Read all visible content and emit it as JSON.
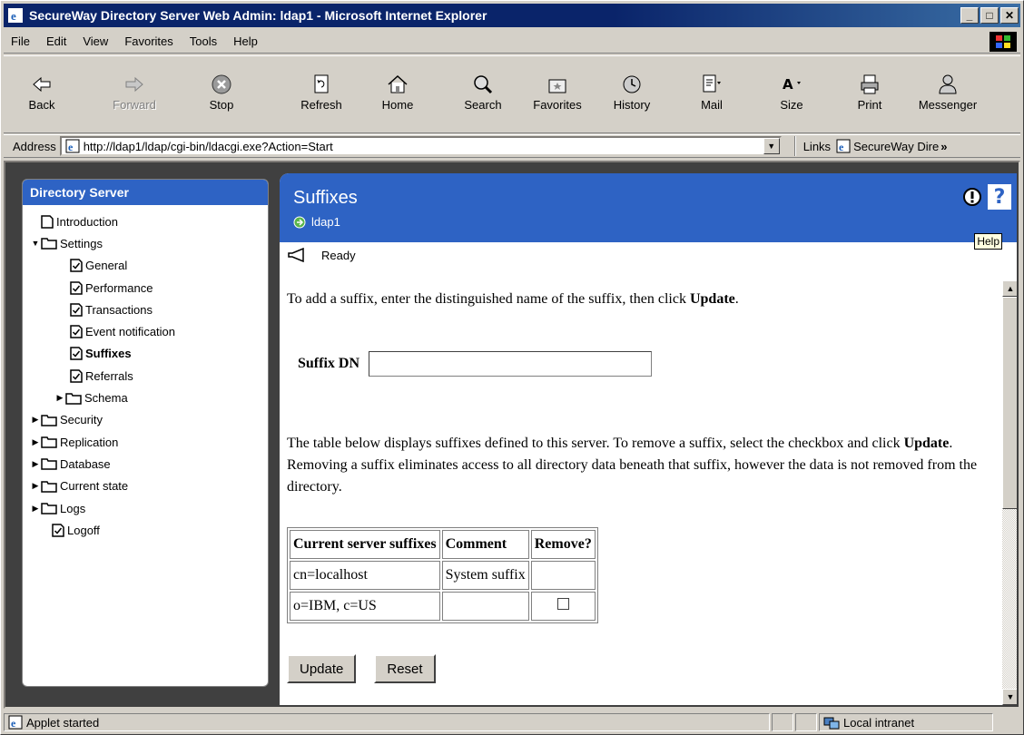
{
  "window": {
    "title": "SecureWay Directory Server Web Admin: ldap1 - Microsoft Internet Explorer"
  },
  "menu": [
    "File",
    "Edit",
    "View",
    "Favorites",
    "Tools",
    "Help"
  ],
  "toolbar": {
    "back": "Back",
    "forward": "Forward",
    "stop": "Stop",
    "refresh": "Refresh",
    "home": "Home",
    "search": "Search",
    "favorites": "Favorites",
    "history": "History",
    "mail": "Mail",
    "size": "Size",
    "print": "Print",
    "messenger": "Messenger"
  },
  "address": {
    "label": "Address",
    "url": "http://ldap1/ldap/cgi-bin/ldacgi.exe?Action=Start",
    "links_label": "Links",
    "links_item": "SecureWay Dire"
  },
  "nav": {
    "header": "Directory Server",
    "items": [
      "Introduction",
      "Settings",
      "General",
      "Performance",
      "Transactions",
      "Event notification",
      "Suffixes",
      "Referrals",
      "Schema",
      "Security",
      "Replication",
      "Database",
      "Current state",
      "Logs",
      "Logoff"
    ]
  },
  "panel": {
    "title": "Suffixes",
    "server": "ldap1",
    "help_tooltip": "Help",
    "status": "Ready",
    "intro_pre": "To add a suffix, enter the distinguished name of the suffix, then click ",
    "intro_bold": "Update",
    "intro_post": ".",
    "suffix_dn_label": "Suffix DN",
    "suffix_dn_value": "",
    "desc_pre": "The table below displays suffixes defined to this server. To remove a suffix, select the checkbox and click ",
    "desc_bold": "Update",
    "desc_post": ". Removing a suffix eliminates access to all directory data beneath that suffix, however the data is not removed from the directory.",
    "table": {
      "headers": [
        "Current server suffixes",
        "Comment",
        "Remove?"
      ],
      "rows": [
        {
          "suffix": "cn=localhost",
          "comment": "System suffix",
          "removable": false
        },
        {
          "suffix": "o=IBM, c=US",
          "comment": "",
          "removable": true,
          "checked": false
        }
      ]
    },
    "update_button": "Update",
    "reset_button": "Reset"
  },
  "statusbar": {
    "left": "Applet started",
    "zone": "Local intranet"
  }
}
